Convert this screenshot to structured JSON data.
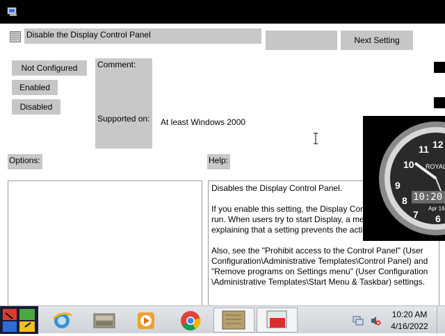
{
  "window": {
    "icon": "policy-app-icon"
  },
  "header": {
    "policy_title": "Disable the Display Control Panel",
    "prev_setting_label": "",
    "next_setting_label": "Next Setting"
  },
  "state_options": [
    {
      "label": "Not Configured"
    },
    {
      "label": "Enabled"
    },
    {
      "label": "Disabled"
    }
  ],
  "comment_label": "Comment:",
  "supported_on_label": "Supported on:",
  "supported_on_value": "At least Windows 2000",
  "options_label": "Options:",
  "help_label": "Help:",
  "help_text": [
    "Disables the Display Control Panel.",
    "If you enable this setting, the Display Con... run. When users try to start Display, a mes... explaining that a setting prevents the acti...",
    "Also, see the \"Prohibit access to the Control Panel\" (User Configuration\\Administrative Templates\\Control Panel) and \"Remove programs on Settings menu\" (User Configuration \\Administrative Templates\\Start Menu & Taskbar) settings."
  ],
  "help_lines": [
    "Disables the Display Control Panel.",
    "If you enable this setting, the Display Con",
    "run. When users try to start Display, a mes",
    "explaining that a setting prevents the actio",
    "Also, see the \"Prohibit access to the Control Panel\" (User",
    "Configuration\\Administrative Templates\\Control Panel) and",
    "\"Remove programs on Settings menu\" (User Configuration",
    "\\Administrative Templates\\Start Menu & Taskbar) settings."
  ],
  "clock_widget": {
    "brand": "ROYAL",
    "time": "10:20",
    "date": "Apr 16"
  },
  "taskbar": {
    "apps": [
      {
        "name": "start-button-icon"
      },
      {
        "name": "ie-icon"
      },
      {
        "name": "app-icon-1"
      },
      {
        "name": "media-player-icon"
      },
      {
        "name": "chrome-icon"
      },
      {
        "name": "app-icon-2"
      },
      {
        "name": "app-icon-3"
      }
    ],
    "time": "10:20 AM",
    "date": "4/16/2022"
  },
  "colors": {
    "panel_gray": "#c8c8c8",
    "taskbar_bg": "#d9dce0",
    "title_bar": "#000000"
  }
}
